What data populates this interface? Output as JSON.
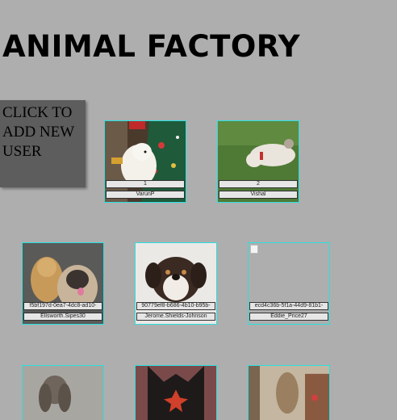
{
  "header": {
    "title": "ANIMAL FACTORY"
  },
  "add_user": {
    "label": "CLICK TO ADD NEW USER"
  },
  "users": [
    {
      "id": "1",
      "name": "VarunP",
      "photo": "dog-christmas-tree"
    },
    {
      "id": "2",
      "name": "Vishal",
      "photo": "dog-on-grass"
    },
    {
      "id": "f5bf197d-0ea7-4dc8-ad10-",
      "name": "Ellsworth.Sipes30",
      "photo": "golden-retriever-and-pug"
    },
    {
      "id": "90779ef8-b686-4b10-b95b-",
      "name": "Jerome.Shields-Johnson",
      "photo": "puppy-portrait"
    },
    {
      "id": "ecd4c36b-5f1a-44d9-81b1-",
      "name": "Eddie_Price27",
      "photo": "broken-image"
    },
    {
      "id": "",
      "name": "",
      "photo": "cocker-spaniel"
    },
    {
      "id": "",
      "name": "",
      "photo": "dog-with-leaf"
    },
    {
      "id": "",
      "name": "",
      "photo": "greyhound-indoors"
    }
  ]
}
